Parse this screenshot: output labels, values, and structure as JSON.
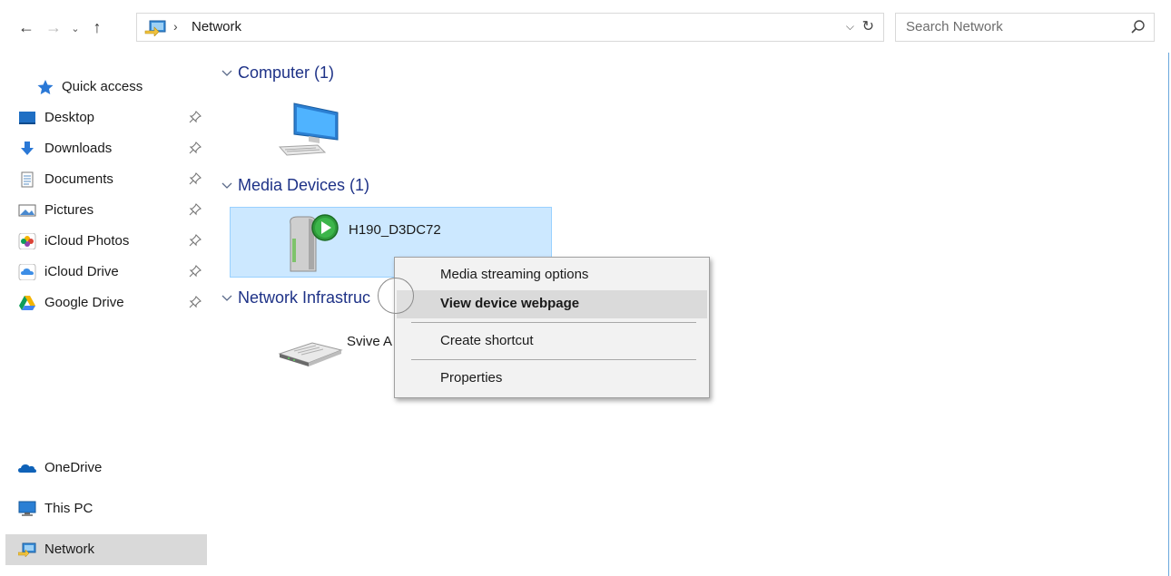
{
  "address": {
    "location": "Network",
    "separator": "›"
  },
  "search": {
    "placeholder": "Search Network"
  },
  "sidebar": {
    "quick_access": "Quick access",
    "items": [
      {
        "label": "Desktop",
        "icon": "desktop-icon",
        "pinned": true
      },
      {
        "label": "Downloads",
        "icon": "downloads-icon",
        "pinned": true
      },
      {
        "label": "Documents",
        "icon": "documents-icon",
        "pinned": true
      },
      {
        "label": "Pictures",
        "icon": "pictures-icon",
        "pinned": true
      },
      {
        "label": "iCloud Photos",
        "icon": "icloud-photos-icon",
        "pinned": true
      },
      {
        "label": "iCloud Drive",
        "icon": "icloud-drive-icon",
        "pinned": true
      },
      {
        "label": "Google Drive",
        "icon": "google-drive-icon",
        "pinned": true
      }
    ],
    "onedrive": "OneDrive",
    "this_pc": "This PC",
    "network": "Network",
    "selected": "Network"
  },
  "groups": {
    "computer": {
      "title": "Computer (1)"
    },
    "media": {
      "title": "Media Devices (1)",
      "device": "H190_D3DC72"
    },
    "infra": {
      "title": "Network Infrastruc",
      "device": "Svive A"
    }
  },
  "context_menu": {
    "items": [
      {
        "label": "Media streaming options",
        "bold": false,
        "highlighted": false
      },
      {
        "label": "View device webpage",
        "bold": true,
        "highlighted": true
      },
      {
        "label": "Create shortcut",
        "bold": false,
        "highlighted": false
      },
      {
        "label": "Properties",
        "bold": false,
        "highlighted": false
      }
    ]
  },
  "colors": {
    "group_title": "#1e3287",
    "selection_bg": "#cce8ff",
    "selection_border": "#99d1ff",
    "accent": "#69a7dc"
  }
}
